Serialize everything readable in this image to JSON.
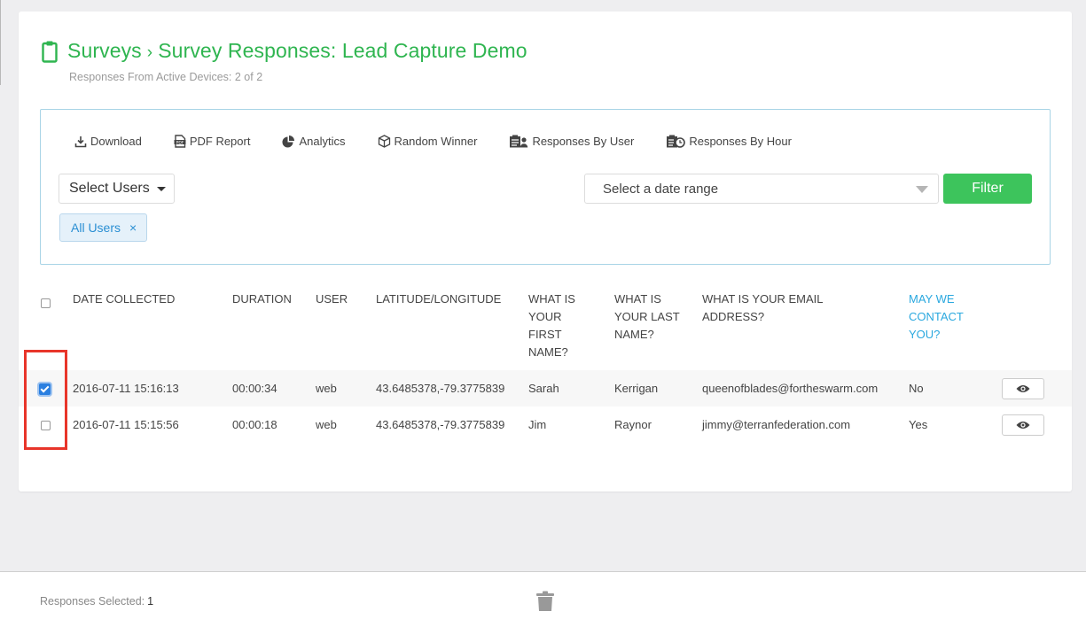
{
  "header": {
    "breadcrumb_root": "Surveys",
    "separator": "›",
    "title": "Survey Responses: Lead Capture Demo",
    "subtitle": "Responses From Active Devices: 2 of 2",
    "title_icon": "clipboard-icon"
  },
  "toolbar": {
    "download": "Download",
    "pdf_report": "PDF Report",
    "analytics": "Analytics",
    "random_winner": "Random Winner",
    "responses_by_user": "Responses By User",
    "responses_by_hour": "Responses By Hour"
  },
  "filters": {
    "select_users": "Select Users",
    "date_range_placeholder": "Select a date range",
    "filter_button": "Filter",
    "tag_label": "All Users",
    "tag_remove": "×"
  },
  "table": {
    "columns": {
      "date": "DATE COLLECTED",
      "duration": "DURATION",
      "user": "USER",
      "latlng": "LATITUDE/LONGITUDE",
      "first_name": "WHAT IS YOUR FIRST NAME?",
      "last_name": "WHAT IS YOUR LAST NAME?",
      "email": "WHAT IS YOUR EMAIL ADDRESS?",
      "contact": "MAY WE CONTACT YOU?"
    },
    "rows": [
      {
        "checked": true,
        "date": "2016-07-11 15:16:13",
        "duration": "00:00:34",
        "user": "web",
        "latlng": "43.6485378,-79.3775839",
        "first_name": "Sarah",
        "last_name": "Kerrigan",
        "email": "queenofblades@fortheswarm.com",
        "contact": "No"
      },
      {
        "checked": false,
        "date": "2016-07-11 15:15:56",
        "duration": "00:00:18",
        "user": "web",
        "latlng": "43.6485378,-79.3775839",
        "first_name": "Jim",
        "last_name": "Raynor",
        "email": "jimmy@terranfederation.com",
        "contact": "Yes"
      }
    ]
  },
  "footer": {
    "selected_label": "Responses Selected:",
    "selected_count": "1"
  },
  "colors": {
    "accent": "#2fb550",
    "filter_button": "#3dc45c",
    "link": "#2aa8df",
    "highlight": "#e8352a"
  }
}
